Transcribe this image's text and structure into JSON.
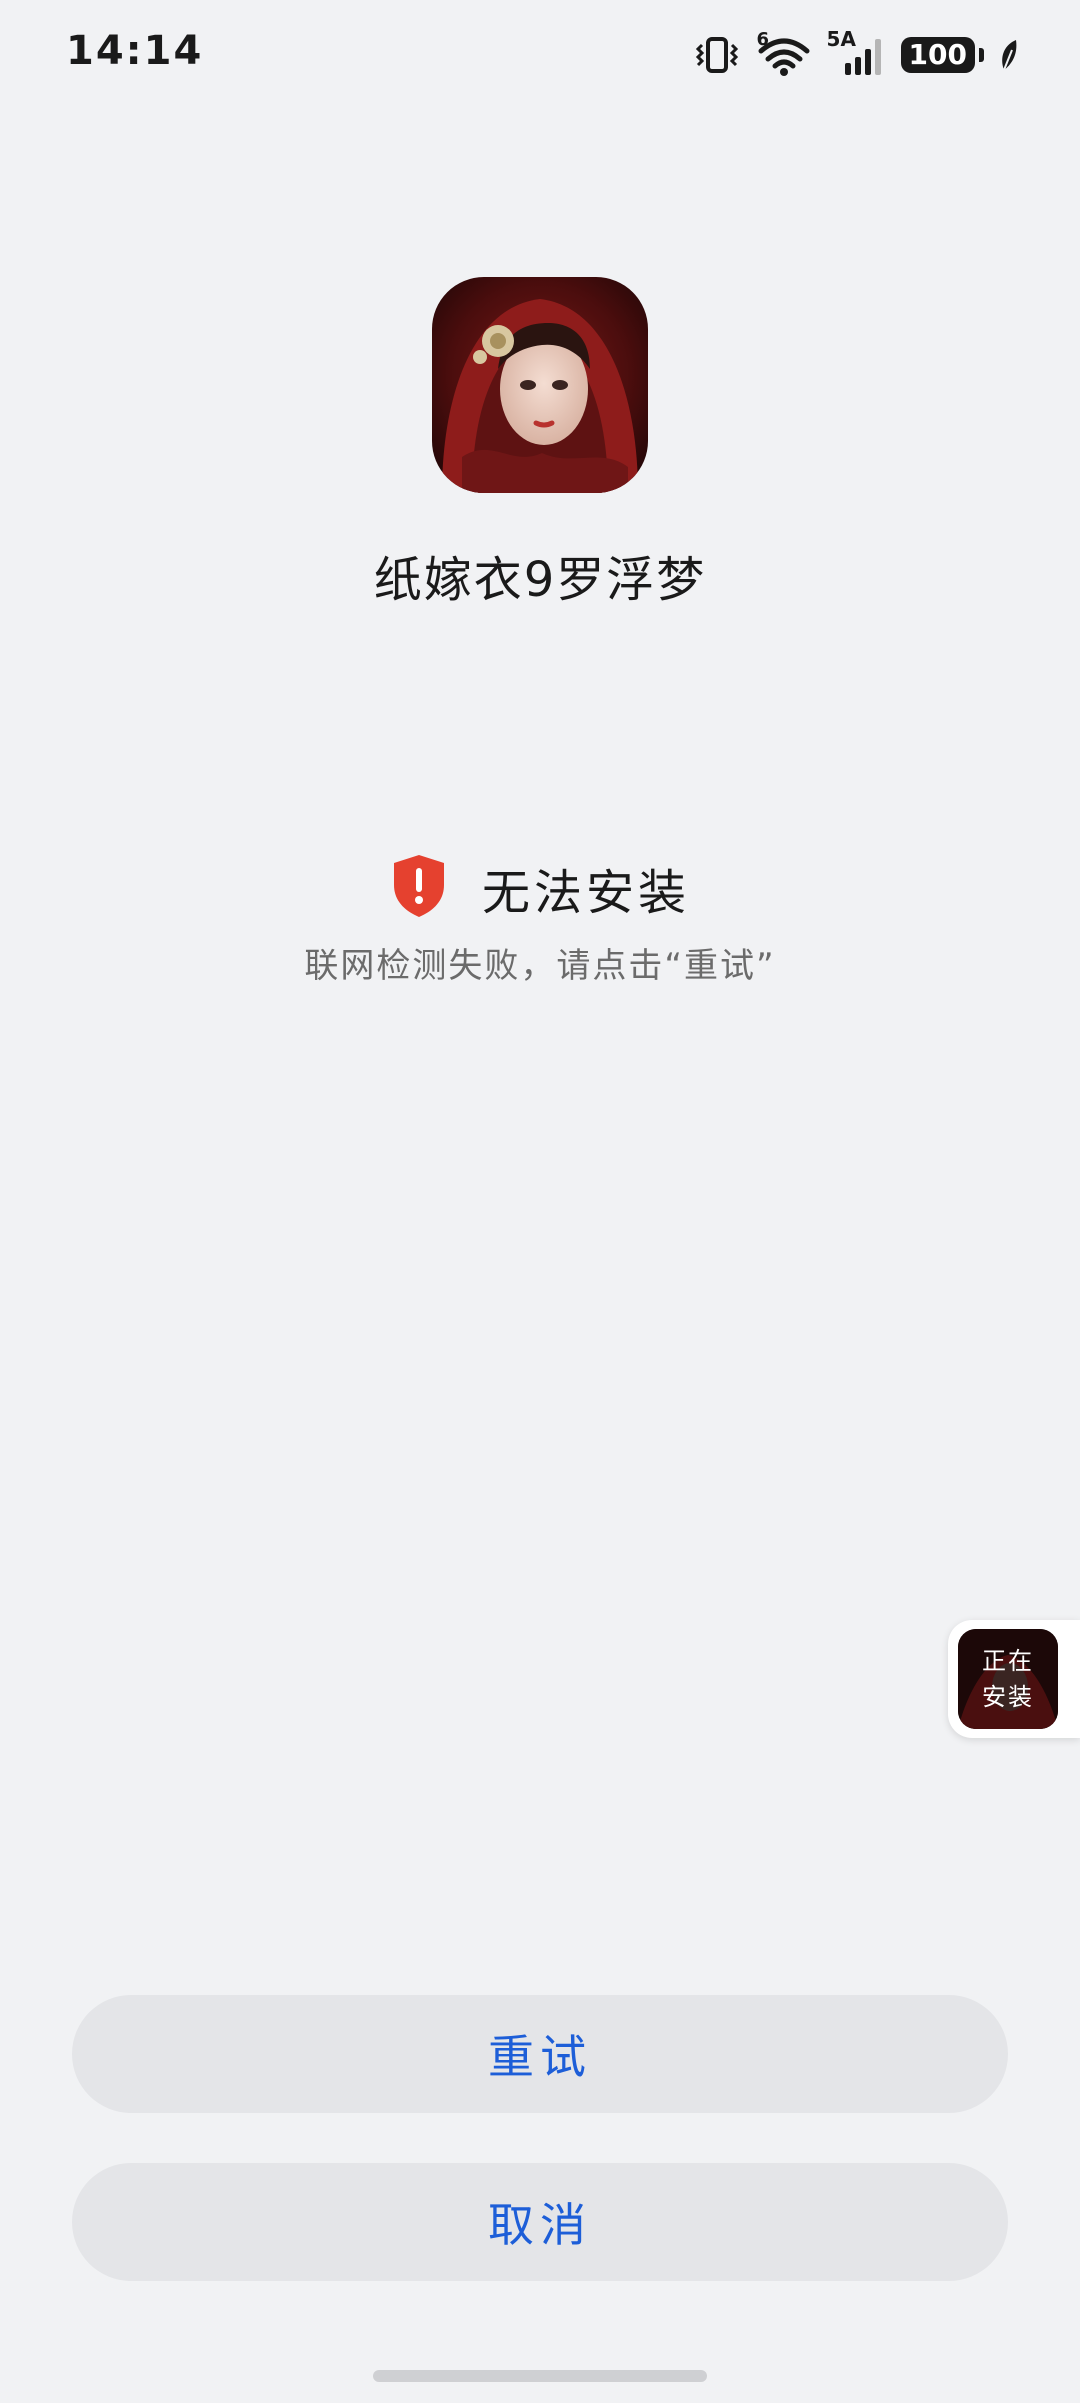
{
  "status_bar": {
    "time": "14:14",
    "network_label": "6",
    "signal_label": "5A",
    "battery": "100",
    "icons": [
      "vibrate-icon",
      "wifi-icon",
      "signal-icon",
      "battery-icon",
      "leaf-icon"
    ]
  },
  "app": {
    "name": "纸嫁衣9罗浮梦",
    "icon": "app-icon-portrait"
  },
  "install_status": {
    "icon": "shield-alert-icon",
    "title": "无法安装",
    "description": "联网检测失败，请点击“重试”"
  },
  "floating_chip": {
    "line1": "正在",
    "line2": "安装"
  },
  "buttons": {
    "retry": "重试",
    "cancel": "取消"
  },
  "colors": {
    "background": "#f1f2f4",
    "button_bg": "#e4e5e8",
    "accent": "#1d5ed8",
    "alert_red": "#e5412f"
  }
}
